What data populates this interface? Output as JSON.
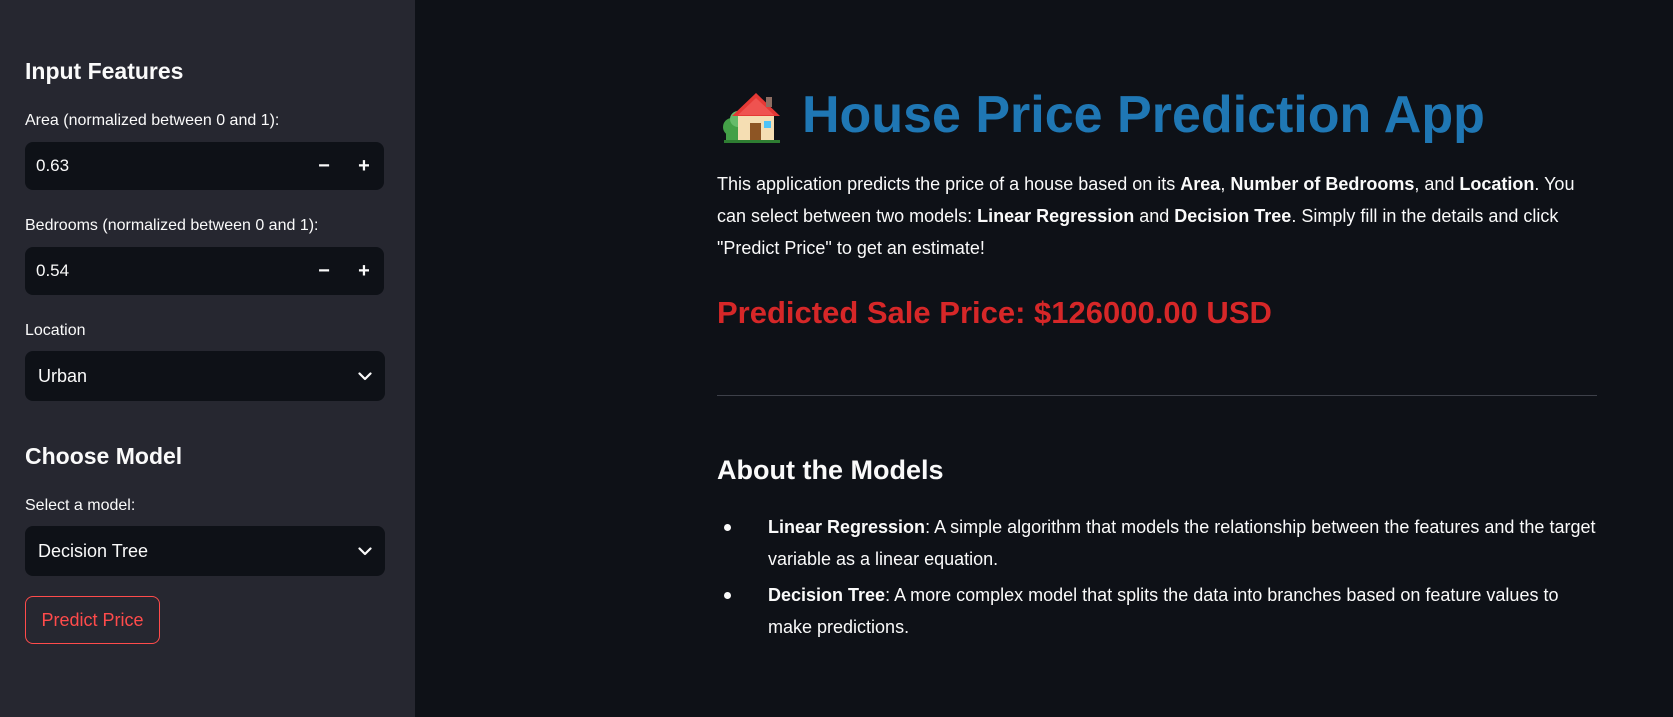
{
  "sidebar": {
    "input_heading": "Input Features",
    "area": {
      "label": "Area (normalized between 0 and 1):",
      "value": "0.63",
      "minus": "−",
      "plus": "+"
    },
    "bedrooms": {
      "label": "Bedrooms (normalized between 0 and 1):",
      "value": "0.54",
      "minus": "−",
      "plus": "+"
    },
    "location": {
      "label": "Location",
      "value": "Urban"
    },
    "model_heading": "Choose Model",
    "model": {
      "label": "Select a model:",
      "value": "Decision Tree"
    },
    "predict_button": "Predict Price"
  },
  "main": {
    "title": "House Price Prediction App",
    "title_icon": "house-emoji",
    "intro": {
      "p1": "This application predicts the price of a house based on its ",
      "b1": "Area",
      "p2": ", ",
      "b2": "Number of Bedrooms",
      "p3": ", and ",
      "b3": "Location",
      "p4": ". You can select between two models: ",
      "b4": "Linear Regression",
      "p5": " and ",
      "b5": "Decision Tree",
      "p6": ". Simply fill in the details and click \"Predict Price\" to get an estimate!"
    },
    "predicted_price": "Predicted Sale Price: $126000.00 USD",
    "about_heading": "About the Models",
    "models": [
      {
        "name": "Linear Regression",
        "description": ": A simple algorithm that models the relationship between the features and the target variable as a linear equation."
      },
      {
        "name": "Decision Tree",
        "description": ": A more complex model that splits the data into branches based on feature values to make predictions."
      }
    ]
  },
  "colors": {
    "background": "#0e1117",
    "sidebar": "#262730",
    "title": "#1f77b4",
    "predicted": "#d62728",
    "accent": "#ff4b4b"
  }
}
